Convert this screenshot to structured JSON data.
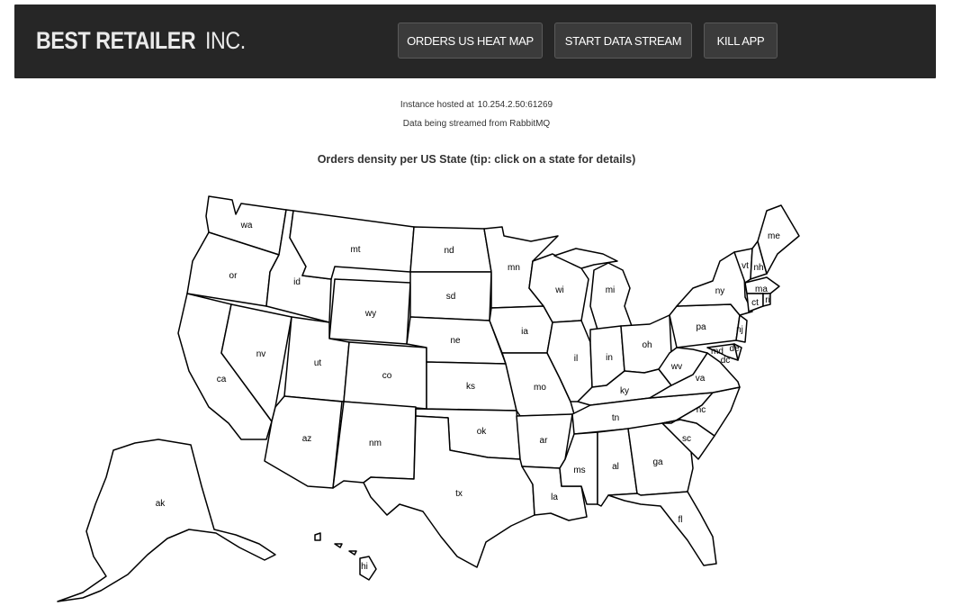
{
  "brand": {
    "bold": "BEST RETAILER",
    "light": "INC."
  },
  "nav": {
    "heat_map": "ORDERS US HEAT MAP",
    "start_stream": "START DATA STREAM",
    "kill_app": "KILL APP"
  },
  "info": {
    "host_label": "Instance hosted at",
    "host_value": "10.254.2.50:61269",
    "stream_text": "Data being streamed from RabbitMQ"
  },
  "map": {
    "title": "Orders density per US State (tip: click on a state for details)",
    "states": {
      "wa": "wa",
      "or": "or",
      "ca": "ca",
      "nv": "nv",
      "id": "id",
      "mt": "mt",
      "wy": "wy",
      "ut": "ut",
      "az": "az",
      "co": "co",
      "nm": "nm",
      "nd": "nd",
      "sd": "sd",
      "ne": "ne",
      "ks": "ks",
      "ok": "ok",
      "tx": "tx",
      "mn": "mn",
      "ia": "ia",
      "mo": "mo",
      "ar": "ar",
      "la": "la",
      "wi": "wi",
      "il": "il",
      "mi": "mi",
      "in": "in",
      "oh": "oh",
      "ky": "ky",
      "tn": "tn",
      "ms": "ms",
      "al": "al",
      "ga": "ga",
      "fl": "fl",
      "sc": "sc",
      "nc": "nc",
      "va": "va",
      "wv": "wv",
      "pa": "pa",
      "ny": "ny",
      "nj": "nj",
      "de": "de",
      "md": "md",
      "vt": "vt",
      "nh": "nh",
      "me": "me",
      "ma": "ma",
      "ct": "ct",
      "ri": "ri",
      "dc": "dc",
      "ak": "ak",
      "hi": "hi"
    }
  },
  "colors": {
    "navbar_bg": "#262626",
    "button_bg": "#3b3b3b",
    "state_fill": "#ffffff",
    "state_stroke": "#000000"
  }
}
